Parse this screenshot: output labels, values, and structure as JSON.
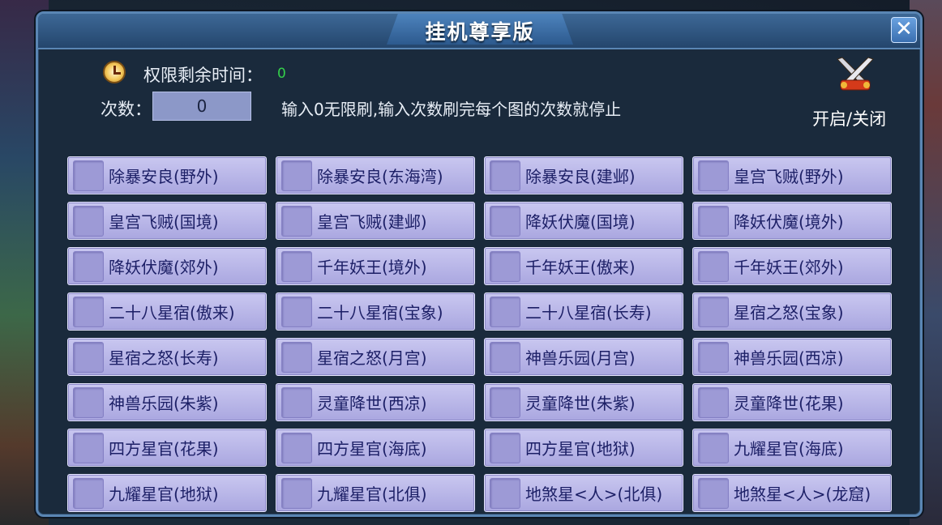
{
  "dialog": {
    "title": "挂机尊享版",
    "close_label": "✕"
  },
  "timer": {
    "label": "权限剩余时间：",
    "value": "0"
  },
  "count": {
    "label": "次数：",
    "value": "0"
  },
  "hint": "输入0无限刷,输入次数刷完每个图的次数就停止",
  "toggle": {
    "label": "开启/关闭",
    "icon": "crossed-swords-icon"
  },
  "colors": {
    "panel_bg": "#1a2a3c",
    "border": "#5a86b4",
    "item_bg": "#b9b7ea",
    "item_text": "#1c1f66",
    "timer_value": "#34d04a"
  },
  "items": [
    {
      "label": "除暴安良(野外)"
    },
    {
      "label": "除暴安良(东海湾)"
    },
    {
      "label": "除暴安良(建邺)"
    },
    {
      "label": "皇宫飞贼(野外)"
    },
    {
      "label": "皇宫飞贼(国境)"
    },
    {
      "label": "皇宫飞贼(建邺)"
    },
    {
      "label": "降妖伏魔(国境)"
    },
    {
      "label": "降妖伏魔(境外)"
    },
    {
      "label": "降妖伏魔(郊外)"
    },
    {
      "label": "千年妖王(境外)"
    },
    {
      "label": "千年妖王(傲来)"
    },
    {
      "label": "千年妖王(郊外)"
    },
    {
      "label": "二十八星宿(傲来)"
    },
    {
      "label": "二十八星宿(宝象)"
    },
    {
      "label": "二十八星宿(长寿)"
    },
    {
      "label": "星宿之怒(宝象)"
    },
    {
      "label": "星宿之怒(长寿)"
    },
    {
      "label": "星宿之怒(月宫)"
    },
    {
      "label": "神兽乐园(月宫)"
    },
    {
      "label": "神兽乐园(西凉)"
    },
    {
      "label": "神兽乐园(朱紫)"
    },
    {
      "label": "灵童降世(西凉)"
    },
    {
      "label": "灵童降世(朱紫)"
    },
    {
      "label": "灵童降世(花果)"
    },
    {
      "label": "四方星官(花果)"
    },
    {
      "label": "四方星官(海底)"
    },
    {
      "label": "四方星官(地狱)"
    },
    {
      "label": "九耀星官(海底)"
    },
    {
      "label": "九耀星官(地狱)"
    },
    {
      "label": "九耀星官(北俱)"
    },
    {
      "label": "地煞星<人>(北俱)"
    },
    {
      "label": "地煞星<人>(龙窟)"
    }
  ]
}
